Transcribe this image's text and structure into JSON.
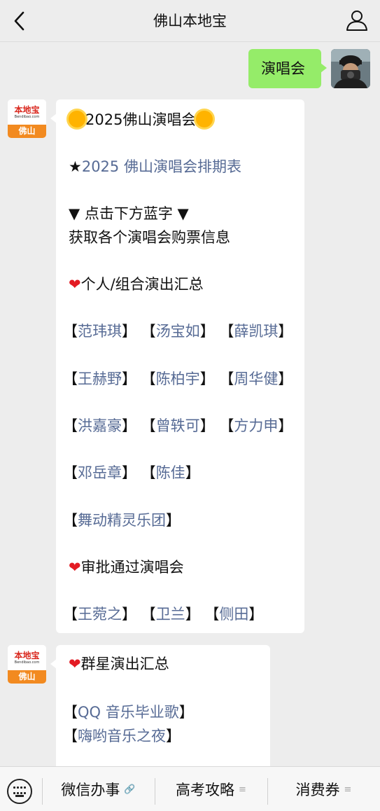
{
  "header": {
    "title": "佛山本地宝"
  },
  "me": {
    "message": "演唱会"
  },
  "bot": {
    "logo_text": "本地宝",
    "logo_url": "Bendibao.com",
    "logo_city": "佛山"
  },
  "msg1": {
    "title": "2025佛山演唱会",
    "schedule_link": "2025 佛山演唱会排期表",
    "click_hint": "▼ 点击下方蓝字 ▼",
    "click_hint2": "获取各个演唱会购票信息",
    "section1": "个人/组合演出汇总",
    "row1": [
      "范玮琪",
      "汤宝如",
      "薛凯琪"
    ],
    "row2": [
      "王赫野",
      "陈柏宇",
      "周华健"
    ],
    "row3": [
      "洪嘉豪",
      "曾轶可",
      "方力申"
    ],
    "row4": [
      "邓岳章",
      "陈佳"
    ],
    "row5": [
      "舞动精灵乐团"
    ],
    "section2": "审批通过演唱会",
    "row6": [
      "王菀之",
      "卫兰",
      "侧田"
    ]
  },
  "msg2": {
    "section": "群星演出汇总",
    "links": [
      "QQ 音乐毕业歌",
      "嗨哟音乐之夜"
    ]
  },
  "bottom_menu": {
    "item1": "微信办事",
    "item2": "高考攻略",
    "item3": "消费券"
  }
}
